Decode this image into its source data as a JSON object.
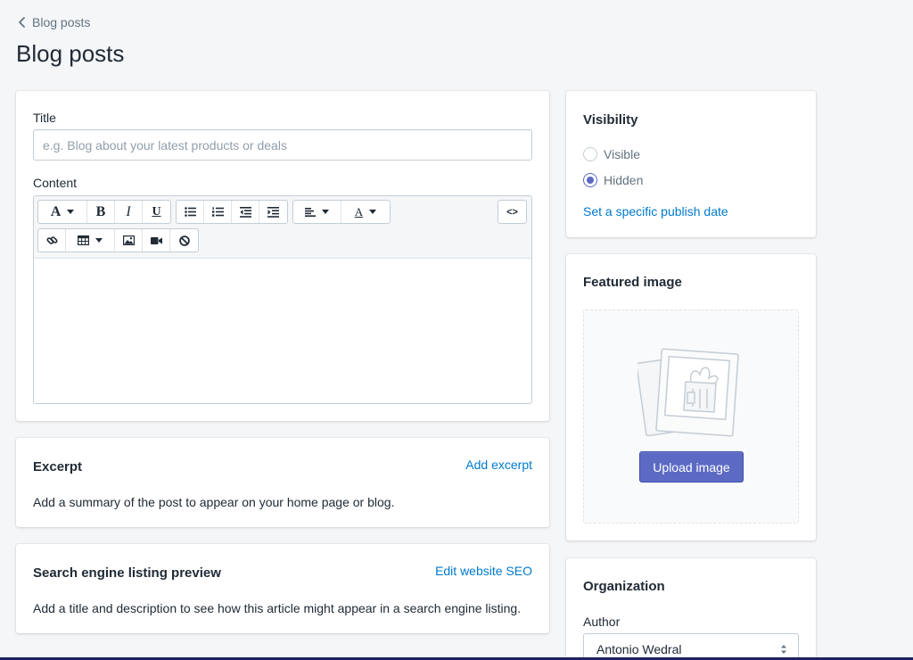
{
  "breadcrumb": {
    "label": "Blog posts"
  },
  "page": {
    "title": "Blog posts"
  },
  "post_form": {
    "title_label": "Title",
    "title_placeholder": "e.g. Blog about your latest products or deals",
    "title_value": "",
    "content_label": "Content",
    "toolbar": {
      "font_letter": "A",
      "bold": "B",
      "italic": "I",
      "underline": "U",
      "text_color_letter": "A",
      "source_code": "<>"
    }
  },
  "excerpt": {
    "title": "Excerpt",
    "action": "Add excerpt",
    "description": "Add a summary of the post to appear on your home page or blog."
  },
  "seo": {
    "title": "Search engine listing preview",
    "action": "Edit website SEO",
    "description": "Add a title and description to see how this article might appear in a search engine listing."
  },
  "visibility": {
    "title": "Visibility",
    "options": [
      {
        "label": "Visible",
        "selected": false
      },
      {
        "label": "Hidden",
        "selected": true
      }
    ],
    "publish_date_link": "Set a specific publish date"
  },
  "featured_image": {
    "title": "Featured image",
    "upload_label": "Upload image"
  },
  "organization": {
    "title": "Organization",
    "author_label": "Author",
    "author_value": "Antonio Wedral"
  },
  "colors": {
    "accent": "#5c6ac4",
    "link": "#007ace",
    "background": "#f4f6f8"
  }
}
